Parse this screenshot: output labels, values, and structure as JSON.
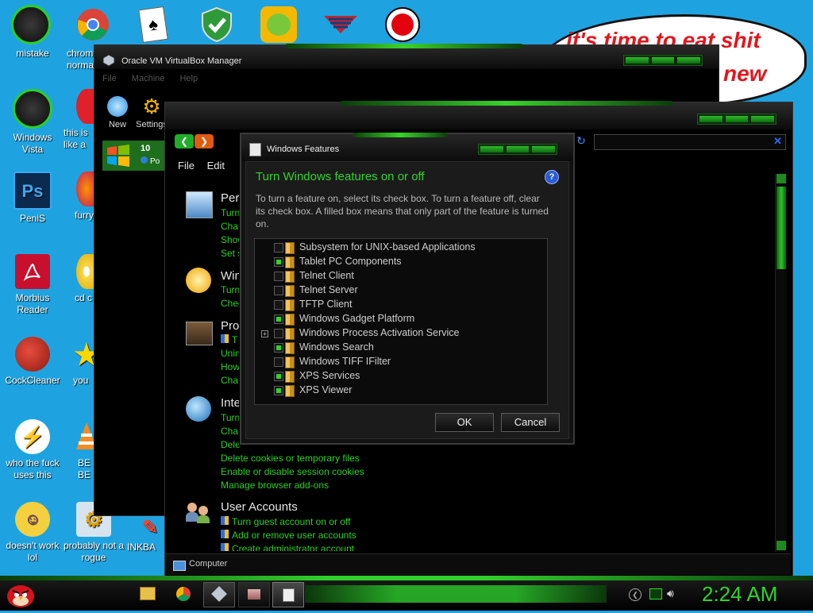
{
  "desktop": {
    "left_icons": [
      {
        "label": "mistake"
      },
      {
        "label": "Windows Vista"
      },
      {
        "label": "PeniS"
      },
      {
        "label": "Morbius Reader"
      },
      {
        "label": "CockCleaner"
      },
      {
        "label": "who the fuck uses this"
      },
      {
        "label": "doesn't work lol"
      }
    ],
    "second_icons": [
      {
        "label": "chrome normal"
      },
      {
        "label": "this is like a"
      },
      {
        "label": "furry"
      },
      {
        "label": "cd c"
      },
      {
        "label": "you"
      },
      {
        "label": "BE BE"
      },
      {
        "label": "probably not a rogue"
      }
    ],
    "third_icon_label": "INKBA",
    "bubble_line1": "it's time to eat shit",
    "bubble_line2": "new",
    "ps_glyph": "Ps"
  },
  "vbox": {
    "title": "Oracle VM VirtualBox Manager",
    "menu": [
      "File",
      "Machine",
      "Help"
    ],
    "toolbar": [
      {
        "label": "New"
      },
      {
        "label": "Settings"
      }
    ],
    "vm_name": "10",
    "vm_state": "Po"
  },
  "control_panel": {
    "menu": [
      "File",
      "Edit"
    ],
    "sections": [
      {
        "head": "Pers",
        "links": [
          "Turn",
          "Cha",
          "Show",
          "Set s"
        ]
      },
      {
        "head": "Win",
        "links": [
          "Turn",
          "Chec"
        ]
      },
      {
        "head": "Pro",
        "links": [
          "T",
          "Unin",
          "How",
          "Cha"
        ]
      },
      {
        "head": "Inte",
        "links": [
          "Turn",
          "Cha",
          "Dele",
          "Delete cookies or temporary files",
          "Enable or disable session cookies",
          "Manage browser add-ons"
        ]
      },
      {
        "head": "User Accounts",
        "links": [
          "Turn guest account on or off",
          "Add or remove user accounts",
          "Create administrator account"
        ]
      }
    ],
    "status": "Computer",
    "close_glyph": "✕"
  },
  "dialog": {
    "title": "Windows Features",
    "heading": "Turn Windows features on or off",
    "description": "To turn a feature on, select its check box. To turn a feature off, clear its check box. A filled box means that only part of the feature is turned on.",
    "features": [
      {
        "name": "Subsystem for UNIX-based Applications",
        "checked": false
      },
      {
        "name": "Tablet PC Components",
        "checked": true
      },
      {
        "name": "Telnet Client",
        "checked": false
      },
      {
        "name": "Telnet Server",
        "checked": false
      },
      {
        "name": "TFTP Client",
        "checked": false
      },
      {
        "name": "Windows Gadget Platform",
        "checked": true
      },
      {
        "name": "Windows Process Activation Service",
        "checked": false,
        "expandable": true
      },
      {
        "name": "Windows Search",
        "checked": true
      },
      {
        "name": "Windows TIFF IFilter",
        "checked": false
      },
      {
        "name": "XPS Services",
        "checked": true
      },
      {
        "name": "XPS Viewer",
        "checked": true
      }
    ],
    "ok_label": "OK",
    "cancel_label": "Cancel",
    "help_glyph": "?"
  },
  "taskbar": {
    "clock": "2:24 AM"
  },
  "colors": {
    "accent": "#27d322",
    "desktop": "#1fa3e0"
  }
}
